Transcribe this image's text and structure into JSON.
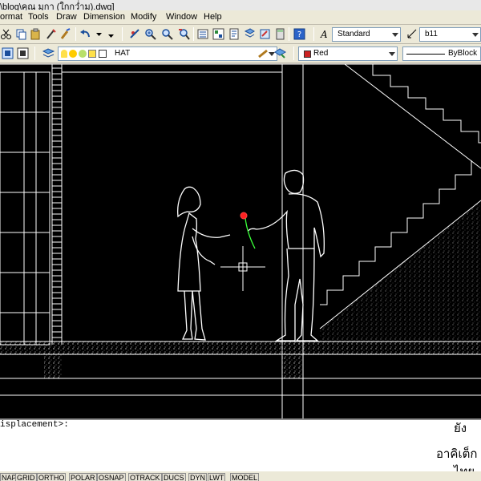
{
  "window": {
    "title": "\\blog\\คุณ มุกา (ใกกว่ำม).dwg]"
  },
  "menu": {
    "items": [
      "ormat",
      "Tools",
      "Draw",
      "Dimension",
      "Modify",
      "Window",
      "Help"
    ]
  },
  "toolbar_styles": {
    "text_style": "Standard",
    "dim_style": "b11"
  },
  "toolbar_layers": {
    "layer": "HAT",
    "color_label": "Red",
    "color_swatch": "#cc2222",
    "linetype": "ByBlock"
  },
  "command": {
    "line1": "isplacement>:",
    "thai1": "ยัง",
    "thai2": "อาคิเต็ก",
    "thai3": "ไทย"
  },
  "status": {
    "buttons": [
      "NAP",
      "GRID",
      "ORTHO",
      "POLAR",
      "OSNAP",
      "OTRACK",
      "DUCS",
      "DYN",
      "LWT",
      "MODEL"
    ]
  },
  "drawing": {
    "background": "#000000",
    "line_color": "#ffffff",
    "accent": "#ff2222"
  }
}
